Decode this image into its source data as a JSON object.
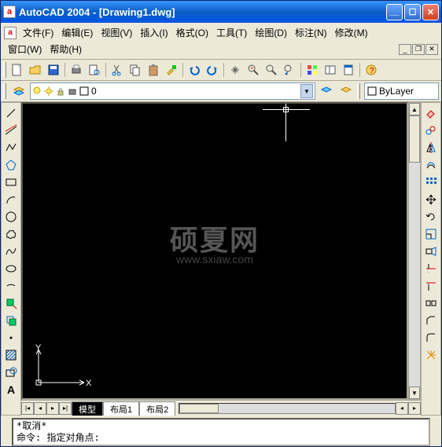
{
  "title": "AutoCAD 2004 - [Drawing1.dwg]",
  "app_icon_letter": "a",
  "menu": {
    "file": "文件(F)",
    "edit": "编辑(E)",
    "view": "视图(V)",
    "insert": "插入(I)",
    "format": "格式(O)",
    "tools": "工具(T)",
    "draw": "绘图(D)",
    "dimension": "标注(N)",
    "modify": "修改(M)",
    "window": "窗口(W)",
    "help": "帮助(H)"
  },
  "layer": {
    "current": "0",
    "bylayer": "ByLayer"
  },
  "tabs": {
    "model": "模型",
    "layout1": "布局1",
    "layout2": "布局2"
  },
  "ucs": {
    "x": "X",
    "y": "Y"
  },
  "watermark": {
    "big": "硕夏网",
    "url": "www.sxiaw.com"
  },
  "cmd": {
    "cancel": "*取消*",
    "prompt": "命令: 指定对角点:"
  },
  "left_tool_text": "A",
  "icons": {
    "new": "new",
    "open": "open",
    "save": "save",
    "print": "print",
    "preview": "preview",
    "cut": "cut",
    "copy": "copy",
    "paste": "paste",
    "matchprop": "matchprop",
    "undo": "undo",
    "redo": "redo",
    "pan": "pan",
    "zoomrt": "zoomrt",
    "zoomwin": "zoomwin",
    "zoomprev": "zoomprev",
    "props": "props",
    "dcenter": "dcenter",
    "toolpal": "toolpal",
    "help": "help"
  }
}
